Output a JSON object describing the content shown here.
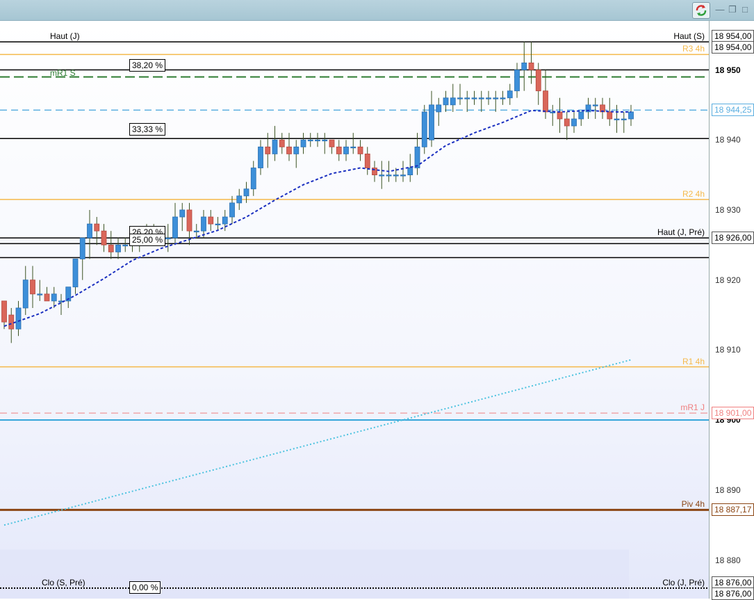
{
  "chart_data": {
    "type": "candlestick",
    "ylim": [
      18874.5,
      18957
    ],
    "y_ticks": [
      {
        "value": 18950,
        "label": "18 950",
        "bold": true
      },
      {
        "value": 18940,
        "label": "18 940"
      },
      {
        "value": 18930,
        "label": "18 930"
      },
      {
        "value": 18920,
        "label": "18 920"
      },
      {
        "value": 18910,
        "label": "18 910"
      },
      {
        "value": 18900,
        "label": "18 900",
        "bold": true
      },
      {
        "value": 18890,
        "label": "18 890"
      },
      {
        "value": 18880,
        "label": "18 880"
      }
    ],
    "price_boxes": [
      {
        "value": 18954.0,
        "label": "18 954,00",
        "color": "#000000",
        "offset": -8
      },
      {
        "value": 18954.0,
        "label": "18 954,00",
        "color": "#000000",
        "offset": 8
      },
      {
        "value": 18944.25,
        "label": "18 944,25",
        "color": "#5aaee0",
        "offset": 0
      },
      {
        "value": 18926.0,
        "label": "18 926,00",
        "color": "#000000",
        "offset": 0
      },
      {
        "value": 18901.0,
        "label": "18 901,00",
        "color": "#f08080",
        "offset": 0
      },
      {
        "value": 18887.17,
        "label": "18 887,17",
        "color": "#8b4513",
        "offset": 0
      },
      {
        "value": 18876.0,
        "label": "18 876,00",
        "color": "#000000",
        "offset": -8
      },
      {
        "value": 18876.0,
        "label": "18 876,00",
        "color": "#000000",
        "offset": 8
      }
    ],
    "levels": [
      {
        "name": "Haut (J)",
        "value": 18954.0,
        "color": "#000000",
        "style": "solid",
        "width": 1.5,
        "label_side": "left"
      },
      {
        "name": "Haut (S)",
        "value": 18954.0,
        "color": "#000000",
        "style": "none",
        "width": 0,
        "label_side": "right"
      },
      {
        "name": "R3 4h",
        "value": 18952.2,
        "color": "#f5b94a",
        "style": "solid",
        "width": 1.5,
        "label_side": "right"
      },
      {
        "name": "",
        "value": 18950.0,
        "color": "#000000",
        "style": "solid",
        "width": 1.5,
        "label_side": "none"
      },
      {
        "name": "mR1 S",
        "value": 18949.0,
        "color": "#2e7d32",
        "style": "dashed",
        "width": 2,
        "label_side": "left"
      },
      {
        "name": "",
        "value": 18944.25,
        "color": "#5aaee0",
        "style": "dashed",
        "width": 1.5,
        "label_side": "none"
      },
      {
        "name": "",
        "value": 18940.2,
        "color": "#000000",
        "style": "solid",
        "width": 1.5,
        "label_side": "none"
      },
      {
        "name": "R2 4h",
        "value": 18931.5,
        "color": "#f5b94a",
        "style": "solid",
        "width": 1.5,
        "label_side": "right"
      },
      {
        "name": "Haut (J, Pré)",
        "value": 18926.0,
        "color": "#000000",
        "style": "solid",
        "width": 1.5,
        "label_side": "right"
      },
      {
        "name": "",
        "value": 18925.2,
        "color": "#000000",
        "style": "solid",
        "width": 1.5,
        "label_side": "none"
      },
      {
        "name": "",
        "value": 18923.2,
        "color": "#000000",
        "style": "solid",
        "width": 1.5,
        "label_side": "none"
      },
      {
        "name": "R1 4h",
        "value": 18907.6,
        "color": "#f5b94a",
        "style": "solid",
        "width": 1.5,
        "label_side": "right"
      },
      {
        "name": "mR1 J",
        "value": 18901.0,
        "color": "#f08080",
        "style": "dashed",
        "width": 1,
        "label_side": "right"
      },
      {
        "name": "",
        "value": 18900.0,
        "color": "#2fa3d8",
        "style": "solid",
        "width": 2,
        "label_side": "none"
      },
      {
        "name": "Piv 4h",
        "value": 18887.17,
        "color": "#8b4513",
        "style": "solid",
        "width": 3,
        "label_side": "right"
      },
      {
        "name": "Clo (S, Pré)",
        "value": 18876.0,
        "color": "#000000",
        "style": "dotted",
        "width": 2,
        "label_side": "left"
      },
      {
        "name": "Clo (J, Pré)",
        "value": 18876.0,
        "color": "#000000",
        "style": "none",
        "width": 0,
        "label_side": "right"
      }
    ],
    "fib_labels": [
      {
        "label": "38,20 %",
        "value": 18950.6
      },
      {
        "label": "33,33 %",
        "value": 18941.5
      },
      {
        "label": "26,20 %",
        "value": 18926.8
      },
      {
        "label": "25,00 %",
        "value": 18925.7
      },
      {
        "label": "0,00 %",
        "value": 18876.1
      }
    ],
    "candles": [
      [
        18917,
        18917,
        18913,
        18914
      ],
      [
        18915,
        18916,
        18911,
        18913
      ],
      [
        18913,
        18917,
        18912,
        18916
      ],
      [
        18916,
        18922,
        18915,
        18920
      ],
      [
        18920,
        18922,
        18916,
        18918
      ],
      [
        18918,
        18920,
        18917,
        18918
      ],
      [
        18918,
        18919,
        18917,
        18917
      ],
      [
        18917,
        18919,
        18916,
        18918
      ],
      [
        18917,
        18918,
        18915,
        18917
      ],
      [
        18917,
        18919,
        18916,
        18919
      ],
      [
        18919,
        18921,
        18918,
        18923
      ],
      [
        18923,
        18925,
        18920,
        18926
      ],
      [
        18926,
        18930,
        18923,
        18928
      ],
      [
        18928,
        18929,
        18925,
        18927
      ],
      [
        18927,
        18928,
        18924,
        18925
      ],
      [
        18925,
        18927,
        18923,
        18924
      ],
      [
        18924,
        18926,
        18923,
        18925
      ],
      [
        18925,
        18926,
        18924,
        18925
      ],
      [
        18925,
        18927,
        18924,
        18926
      ],
      [
        18926,
        18927,
        18924,
        18926
      ],
      [
        18926,
        18928,
        18925,
        18927
      ],
      [
        18927,
        18928,
        18925,
        18926
      ],
      [
        18926,
        18927,
        18925,
        18926
      ],
      [
        18926,
        18928,
        18924,
        18926
      ],
      [
        18926,
        18931,
        18925,
        18929
      ],
      [
        18929,
        18931,
        18927,
        18930
      ],
      [
        18930,
        18931,
        18925,
        18927
      ],
      [
        18927,
        18928,
        18926,
        18927
      ],
      [
        18927,
        18930,
        18926,
        18929
      ],
      [
        18929,
        18930,
        18927,
        18928
      ],
      [
        18928,
        18929,
        18927,
        18928
      ],
      [
        18928,
        18930,
        18927,
        18929
      ],
      [
        18929,
        18932,
        18928,
        18931
      ],
      [
        18931,
        18933,
        18930,
        18932
      ],
      [
        18932,
        18934,
        18931,
        18933
      ],
      [
        18933,
        18937,
        18932,
        18936
      ],
      [
        18936,
        18940,
        18935,
        18939
      ],
      [
        18939,
        18941,
        18936,
        18938
      ],
      [
        18938,
        18942,
        18937,
        18940
      ],
      [
        18940,
        18941,
        18938,
        18939
      ],
      [
        18939,
        18941,
        18937,
        18938
      ],
      [
        18938,
        18940,
        18936,
        18939
      ],
      [
        18939,
        18941,
        18938,
        18940
      ],
      [
        18940,
        18941,
        18939,
        18940
      ],
      [
        18940,
        18941,
        18939,
        18940
      ],
      [
        18940,
        18941,
        18938,
        18940
      ],
      [
        18940,
        18940,
        18938,
        18939
      ],
      [
        18939,
        18940,
        18937,
        18938
      ],
      [
        18938,
        18940,
        18937,
        18939
      ],
      [
        18939,
        18941,
        18938,
        18939
      ],
      [
        18939,
        18940,
        18937,
        18938
      ],
      [
        18938,
        18939,
        18935,
        18936
      ],
      [
        18936,
        18937,
        18934,
        18935
      ],
      [
        18935,
        18937,
        18933,
        18935
      ],
      [
        18935,
        18937,
        18934,
        18935
      ],
      [
        18935,
        18936,
        18934,
        18935
      ],
      [
        18935,
        18937,
        18934,
        18935
      ],
      [
        18935,
        18938,
        18934,
        18936
      ],
      [
        18936,
        18941,
        18935,
        18939
      ],
      [
        18939,
        18945,
        18938,
        18944
      ],
      [
        18940,
        18947,
        18939,
        18945
      ],
      [
        18944,
        18946,
        18942,
        18945
      ],
      [
        18945,
        18947,
        18944,
        18946
      ],
      [
        18945,
        18948,
        18944,
        18946
      ],
      [
        18946,
        18948,
        18945,
        18946
      ],
      [
        18946,
        18947,
        18944,
        18946
      ],
      [
        18946,
        18947,
        18945,
        18946
      ],
      [
        18946,
        18947,
        18944,
        18946
      ],
      [
        18946,
        18947,
        18945,
        18946
      ],
      [
        18946,
        18947,
        18944,
        18946
      ],
      [
        18946,
        18947,
        18945,
        18946
      ],
      [
        18946,
        18948,
        18945,
        18947
      ],
      [
        18947,
        18951,
        18946,
        18950
      ],
      [
        18950,
        18954,
        18947,
        18951
      ],
      [
        18951,
        18954,
        18948,
        18950
      ],
      [
        18950,
        18951,
        18945,
        18947
      ],
      [
        18947,
        18950,
        18943,
        18944
      ],
      [
        18944,
        18945,
        18942,
        18944
      ],
      [
        18944,
        18946,
        18941,
        18943
      ],
      [
        18943,
        18944,
        18940,
        18942
      ],
      [
        18942,
        18944,
        18941,
        18943
      ],
      [
        18943,
        18944,
        18942,
        18944
      ],
      [
        18944,
        18946,
        18943,
        18945
      ],
      [
        18945,
        18946,
        18943,
        18945
      ],
      [
        18945,
        18946,
        18943,
        18944
      ],
      [
        18944,
        18946,
        18942,
        18943
      ],
      [
        18943,
        18945,
        18941,
        18943
      ],
      [
        18943,
        18944,
        18941,
        18943
      ],
      [
        18943,
        18945,
        18942,
        18944
      ]
    ],
    "ma_dashed": [
      [
        0,
        18913.4
      ],
      [
        5,
        18915.2
      ],
      [
        10,
        18917.8
      ],
      [
        14,
        18920.2
      ],
      [
        18,
        18922.8
      ],
      [
        22,
        18924.5
      ],
      [
        26,
        18925.8
      ],
      [
        30,
        18927.1
      ],
      [
        34,
        18929.0
      ],
      [
        38,
        18931.4
      ],
      [
        42,
        18933.6
      ],
      [
        46,
        18935.2
      ],
      [
        50,
        18936.0
      ],
      [
        54,
        18935.5
      ],
      [
        58,
        18936.3
      ],
      [
        62,
        18939.2
      ],
      [
        66,
        18941.0
      ],
      [
        70,
        18942.5
      ],
      [
        74,
        18944.2
      ],
      [
        78,
        18944.0
      ],
      [
        82,
        18944.2
      ],
      [
        86,
        18944.0
      ],
      [
        88,
        18944.0
      ]
    ],
    "ma_dotted": [
      [
        0,
        18885.0
      ],
      [
        88,
        18908.6
      ]
    ]
  }
}
